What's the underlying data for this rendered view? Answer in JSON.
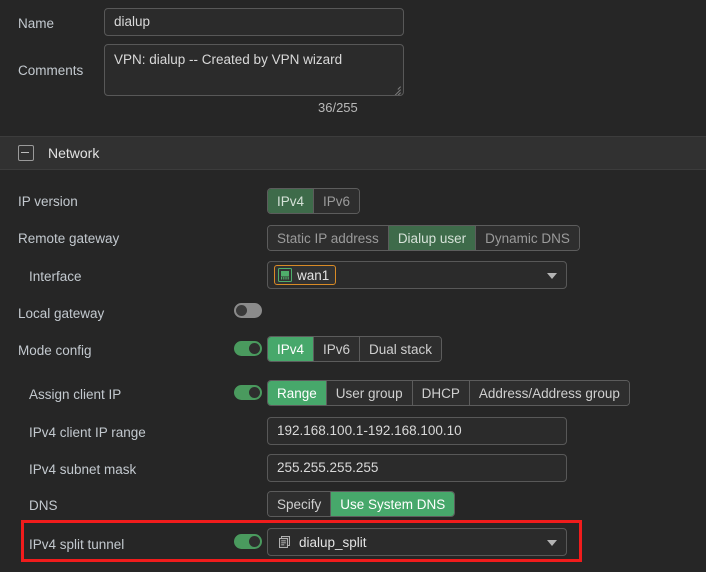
{
  "form": {
    "name": {
      "label": "Name",
      "value": "dialup"
    },
    "comments": {
      "label": "Comments",
      "value": "VPN: dialup -- Created by VPN wizard",
      "counter": "36/255"
    }
  },
  "section": {
    "title": "Network",
    "collapse_icon": "minus-square-icon"
  },
  "rows": {
    "ip_version": {
      "label": "IP version",
      "options": [
        "IPv4",
        "IPv6"
      ],
      "selected": "IPv4"
    },
    "remote_gateway": {
      "label": "Remote gateway",
      "options": [
        "Static IP address",
        "Dialup user",
        "Dynamic DNS"
      ],
      "selected": "Dialup user"
    },
    "interface": {
      "label": "Interface",
      "value": "wan1",
      "icon": "network-interface-icon",
      "caret_icon": "chevron-down-icon"
    },
    "local_gateway": {
      "label": "Local gateway",
      "toggle": "off"
    },
    "mode_config": {
      "label": "Mode config",
      "toggle": "on",
      "options": [
        "IPv4",
        "IPv6",
        "Dual stack"
      ],
      "selected": "IPv4"
    },
    "assign_client_ip": {
      "label": "Assign client IP",
      "toggle": "on",
      "options": [
        "Range",
        "User group",
        "DHCP",
        "Address/Address group"
      ],
      "selected": "Range"
    },
    "client_ip_range": {
      "label": "IPv4 client IP range",
      "value": "192.168.100.1-192.168.100.10"
    },
    "subnet_mask": {
      "label": "IPv4 subnet mask",
      "value": "255.255.255.255"
    },
    "dns": {
      "label": "DNS",
      "options": [
        "Specify",
        "Use System DNS"
      ],
      "selected": "Use System DNS"
    },
    "split_tunnel": {
      "label": "IPv4 split tunnel",
      "toggle": "on",
      "value": "dialup_split",
      "icon": "address-group-icon",
      "caret_icon": "chevron-down-icon"
    }
  },
  "colors": {
    "accent_green": "#47a86b",
    "muted_green": "#3e6b4a",
    "toggle_green": "#4a9a5e",
    "chip_border_orange": "#d98b26",
    "annotation_red": "#f01c1c",
    "background": "#262626",
    "section_header": "#313131"
  }
}
